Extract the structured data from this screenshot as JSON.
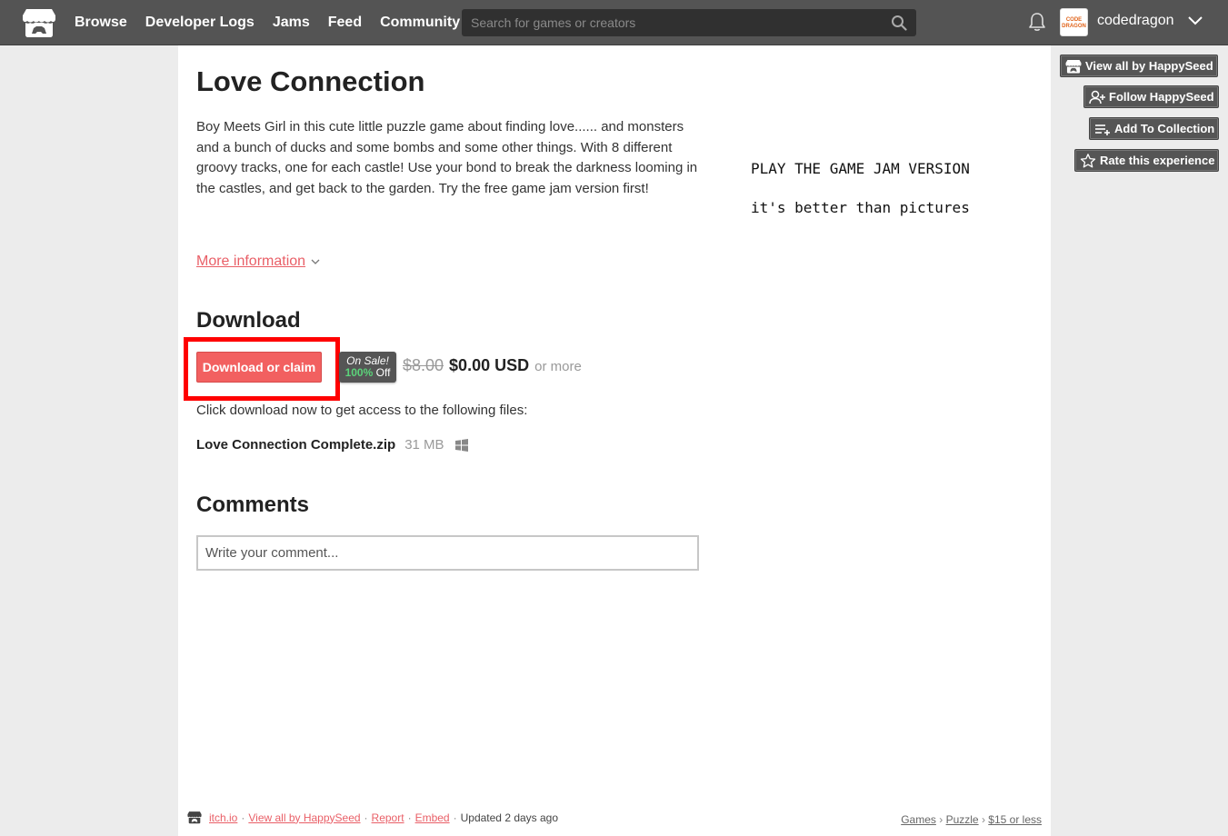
{
  "nav": {
    "items": [
      "Browse",
      "Developer Logs",
      "Jams",
      "Feed",
      "Community"
    ],
    "search_placeholder": "Search for games or creators",
    "username": "codedragon",
    "avatar_text": "CODE DRAGON"
  },
  "game": {
    "title": "Love Connection",
    "description": "Boy Meets Girl in this cute little puzzle game about finding love...... and monsters and a bunch of ducks and some bombs and  some other things. With 8 different groovy tracks, one for each castle! Use  your bond to break the darkness looming in the castles, and get back to the garden. Try the free game jam version first!",
    "side_text_line1": "PLAY THE GAME JAM VERSION",
    "side_text_line2": "it's better than pictures",
    "more_info": "More information"
  },
  "download": {
    "heading": "Download",
    "button_label": "Download or claim",
    "sale_label": "On Sale!",
    "sale_percent": "100%",
    "sale_off": "Off",
    "old_price": "$8.00",
    "new_price": "$0.00 USD",
    "or_more": "or more",
    "access_text": "Click download now to get access to the following files:",
    "file_name": "Love Connection Complete.zip",
    "file_size": "31 MB"
  },
  "comments": {
    "heading": "Comments",
    "placeholder": "Write your comment..."
  },
  "footer": {
    "site": "itch.io",
    "view_all": "View all by HappySeed",
    "report": "Report",
    "embed": "Embed",
    "updated": "Updated 2 days ago",
    "crumbs": [
      "Games",
      "Puzzle",
      "$15 or less"
    ]
  },
  "side_buttons": {
    "view_all": "View all by HappySeed",
    "follow": "Follow HappySeed",
    "add_collection": "Add To Collection",
    "rate": "Rate this experience"
  },
  "colors": {
    "header": "#545454",
    "accent": "#f26060",
    "link": "#e95f67",
    "sale_green": "#5bd37a"
  }
}
